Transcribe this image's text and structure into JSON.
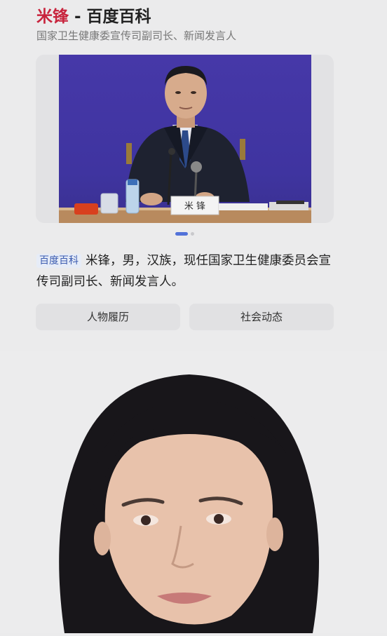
{
  "entry": {
    "name": "米锋",
    "title_suffix": " - 百度百科",
    "subtitle": "国家卫生健康委宣传司副司长、新闻发言人"
  },
  "photo": {
    "nameplate": "米  锋"
  },
  "carousel": {
    "active_index": 1,
    "count": 2
  },
  "abstract": {
    "tag": "百度百科",
    "text": "米锋，男，汉族，现任国家卫生健康委员会宣传司副司长、新闻发言人。"
  },
  "buttons": {
    "resume": "人物履历",
    "news": "社会动态"
  },
  "colors": {
    "accent": "#c8243d",
    "link": "#3c5cb0",
    "backdrop": "#4638a8"
  }
}
